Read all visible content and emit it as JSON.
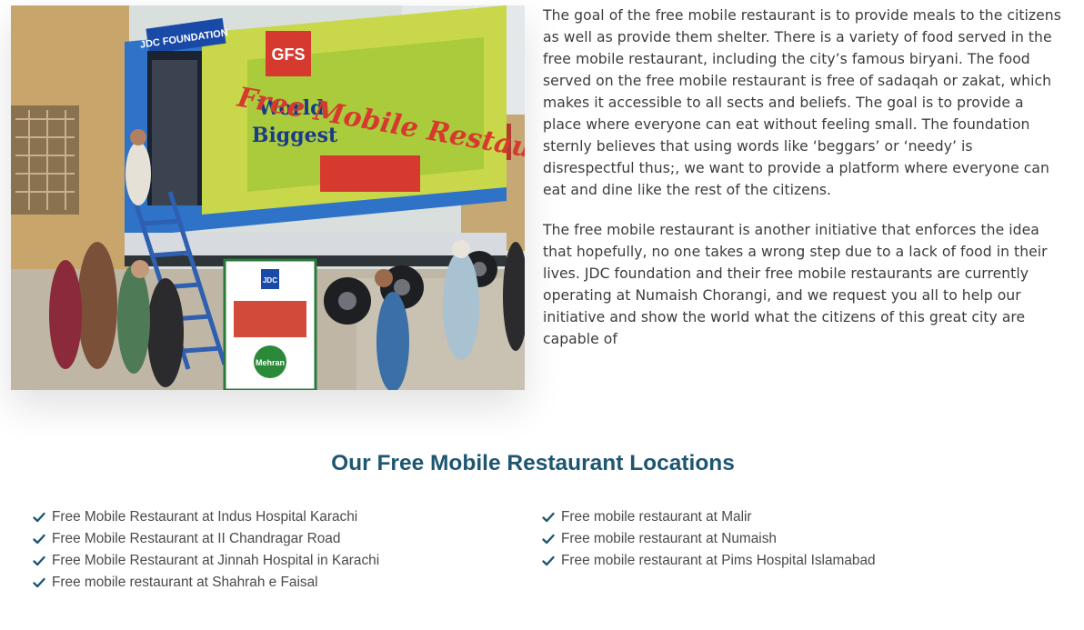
{
  "hero_image": {
    "alt": "JDC Foundation free mobile restaurant truck",
    "truck_text": {
      "brand_top": "JDC FOUNDATION",
      "gfs": "GFS",
      "world": "World",
      "biggest": "Biggest",
      "headline": "Free Mobile Restaurant",
      "standee_brand": "JDC",
      "standee_logo": "Mehran"
    }
  },
  "article": {
    "paragraphs": [
      "The goal of the free mobile restaurant is to provide meals to the citizens as well as provide them shelter. There is a variety of food served in the free mobile restaurant, including the city’s famous biryani. The food served on the free mobile restaurant is free of sadaqah or zakat, which makes it accessible to all sects and beliefs. The goal is to provide a place where everyone can eat without feeling small. The foundation sternly believes that using words like ‘beggars’ or ‘needy’ is disrespectful thus;, we want to provide a platform where everyone can eat and dine like the rest of the citizens.",
      "The free mobile restaurant is another initiative that enforces the idea that hopefully, no one takes a wrong step due to a lack of food in their lives. JDC foundation and their free mobile restaurants are currently operating at Numaish Chorangi, and we request you all to help our initiative and show the world what the citizens of this great city are capable of"
    ]
  },
  "locations": {
    "title": "Our Free Mobile Restaurant Locations",
    "left": [
      "Free Mobile Restaurant at Indus Hospital Karachi",
      "Free Mobile Restaurant at II Chandragar Road",
      "Free Mobile Restaurant at Jinnah Hospital in Karachi",
      "Free mobile restaurant at Shahrah e Faisal"
    ],
    "right": [
      "Free mobile restaurant at Malir",
      "Free mobile restaurant at Numaish",
      "Free mobile restaurant at Pims Hospital Islamabad"
    ]
  },
  "colors": {
    "heading": "#1e5672",
    "check": "#1e5672",
    "body_text": "#3c3c3c"
  },
  "icons": {
    "list_bullet": "check-icon"
  }
}
